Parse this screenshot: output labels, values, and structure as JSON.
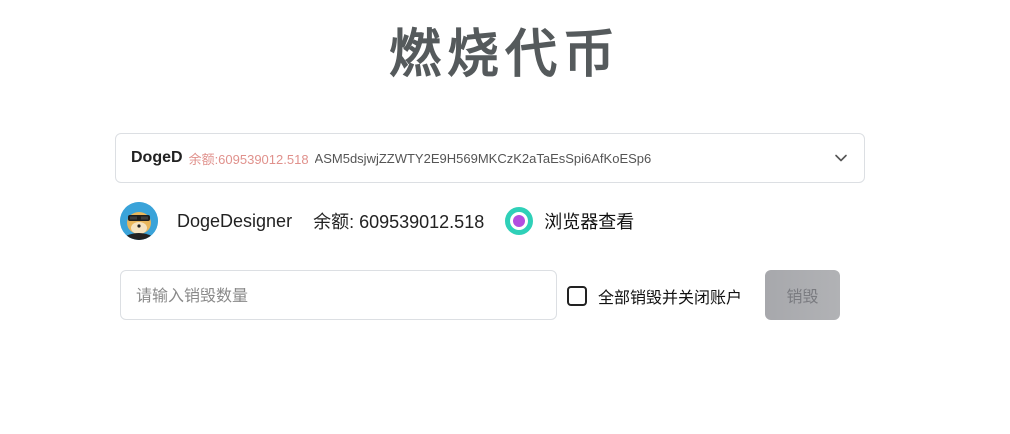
{
  "page": {
    "title": "燃烧代币"
  },
  "token_select": {
    "symbol": "DogeD",
    "balance": "余额:609539012.518",
    "address": "ASM5dsjwjZZWTY2E9H569MKCzK2aTaEsSpi6AfKoESp6"
  },
  "account": {
    "name": "DogeDesigner",
    "balance": "余额: 609539012.518",
    "explorer_label": "浏览器查看"
  },
  "burn_form": {
    "amount_placeholder": "请输入销毁数量",
    "amount_value": "",
    "close_all_label": "全部销毁并关闭账户",
    "close_all_checked": false,
    "burn_button_label": "销毁"
  },
  "colors": {
    "balance_accent": "#e0918c",
    "title": "#555a5c",
    "explorer_ring": "#2fd0b8",
    "explorer_dot": "#b34ee0",
    "button_disabled": "#a7a8ac"
  },
  "icons": {
    "dropdown": "chevron-down-icon",
    "avatar": "doge-avatar",
    "explorer": "explorer-icon",
    "checkbox": "checkbox-unchecked"
  }
}
